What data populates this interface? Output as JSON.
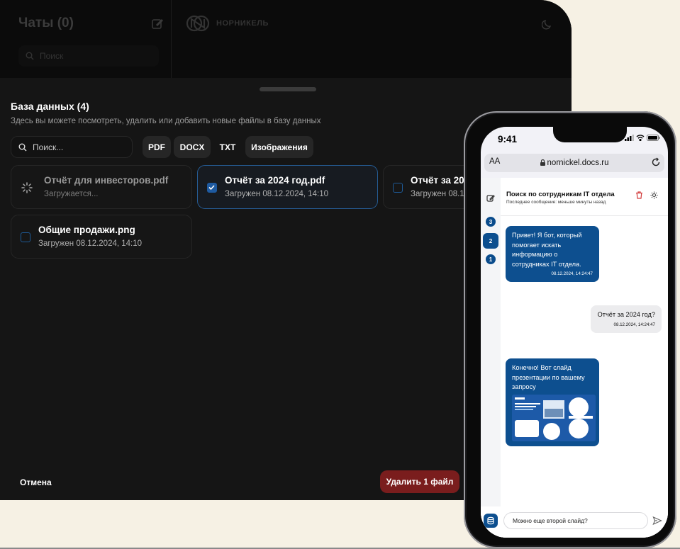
{
  "tablet": {
    "chats_title": "Чаты (0)",
    "search_placeholder": "Поиск",
    "brand_name": "НОРНИКЕЛЬ",
    "database": {
      "title": "База данных (4)",
      "subtitle": "Здесь вы можете посмотреть, удалить или добавить новые файлы в базу данных",
      "search_placeholder": "Поиск...",
      "filters": [
        "PDF",
        "DOCX",
        "TXT",
        "Изображения"
      ],
      "files": [
        {
          "name": "Отчёт для инвесторов.pdf",
          "status": "Загружается...",
          "state": "loading"
        },
        {
          "name": "Отчёт за 2024 год.pdf",
          "status": "Загружен 08.12.2024, 14:10",
          "state": "selected"
        },
        {
          "name": "Отчёт за 20",
          "status": "Загружен 08.1",
          "state": "unselected"
        },
        {
          "name": "Общие продажи.png",
          "status": "Загружен 08.12.2024, 14:10",
          "state": "unselected"
        }
      ],
      "cancel_label": "Отмена",
      "delete_label": "Удалить 1 файл"
    }
  },
  "phone": {
    "status_time": "9:41",
    "browser": {
      "aa_label": "AA",
      "url": "nornickel.docs.ru"
    },
    "sidebar_badges": [
      "3",
      "2",
      "1"
    ],
    "chat": {
      "title": "Поиск по сотрудникам IT отдела",
      "subtitle": "Последнее сообщение: меньше минуты назад",
      "messages": [
        {
          "role": "bot",
          "text": "Привет! Я бот, который помогает искать информацию о сотрудниках IT отдела.",
          "time": "08.12.2024, 14:24:47"
        },
        {
          "role": "user",
          "text": "Отчёт за 2024 год?",
          "time": "08.12.2024, 14:24:47"
        },
        {
          "role": "bot",
          "text": "Конечно! Вот слайд презентации по вашему запросу",
          "time": ""
        }
      ],
      "input_value": "Можно еще второй слайд?"
    }
  },
  "colors": {
    "accent_blue": "#0d4f8f",
    "danger": "#7a1d1d",
    "tablet_bg": "#151515",
    "page_bg": "#f6f1e4"
  }
}
